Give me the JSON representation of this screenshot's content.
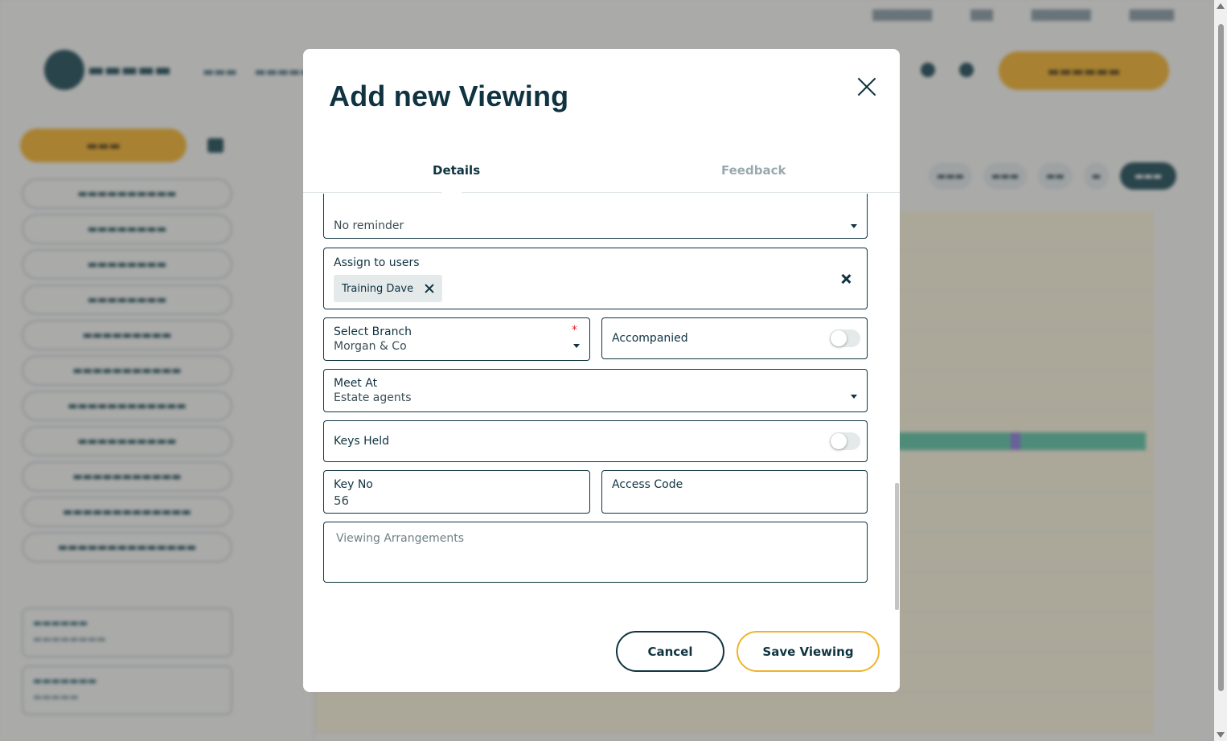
{
  "modal": {
    "title": "Add new Viewing",
    "tabs": [
      {
        "label": "Details",
        "active": true
      },
      {
        "label": "Feedback",
        "active": false
      }
    ],
    "reminder": {
      "value": "No reminder"
    },
    "assign_users": {
      "label": "Assign to users",
      "chips": [
        "Training Dave"
      ]
    },
    "branch": {
      "label": "Select Branch",
      "value": "Morgan & Co",
      "required_mark": "*"
    },
    "accompanied": {
      "label": "Accompanied",
      "on": false
    },
    "meet_at": {
      "label": "Meet At",
      "value": "Estate agents"
    },
    "keys_held": {
      "label": "Keys Held",
      "on": false
    },
    "key_no": {
      "label": "Key No",
      "value": "56"
    },
    "access_code": {
      "label": "Access Code",
      "value": ""
    },
    "viewing_arrangements": {
      "placeholder": "Viewing Arrangements"
    },
    "buttons": {
      "cancel": "Cancel",
      "save": "Save Viewing"
    }
  },
  "colors": {
    "primary": "#0f3340",
    "accent": "#f0b32d",
    "required": "#e0242c",
    "overlay": "rgba(60,60,60,0.42)"
  },
  "icons": {
    "close": "close-icon",
    "chip_remove": "close-icon",
    "clear": "clear-icon",
    "dropdown": "caret-down-icon"
  }
}
